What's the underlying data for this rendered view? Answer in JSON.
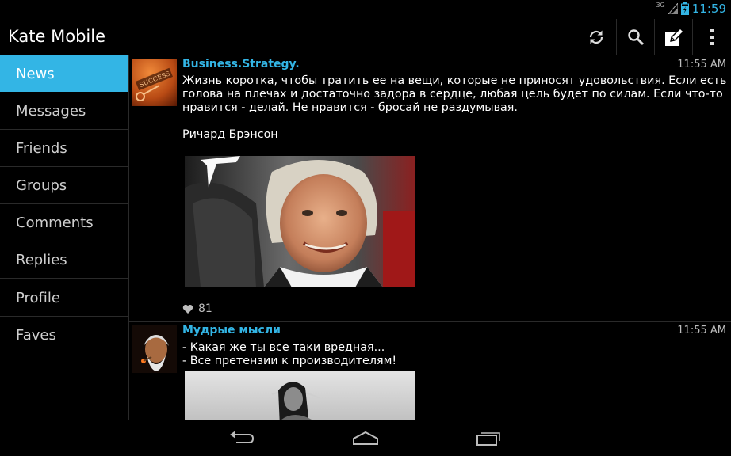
{
  "status": {
    "network": "3G",
    "time": "11:59"
  },
  "app": {
    "title": "Kate Mobile"
  },
  "actions": [
    "refresh-icon",
    "search-icon",
    "compose-icon",
    "overflow-menu-icon"
  ],
  "sidebar": {
    "items": [
      {
        "label": "News",
        "active": true
      },
      {
        "label": "Messages",
        "active": false
      },
      {
        "label": "Friends",
        "active": false
      },
      {
        "label": "Groups",
        "active": false
      },
      {
        "label": "Comments",
        "active": false
      },
      {
        "label": "Replies",
        "active": false
      },
      {
        "label": "Profile",
        "active": false
      },
      {
        "label": "Faves",
        "active": false
      }
    ]
  },
  "posts": [
    {
      "author": "Business.Strategy.",
      "time": "11:55 AM",
      "text_lines": [
        "Жизнь коротка, чтобы тратить ее на вещи, которые не приносят удовольствия. Если есть",
        "голова на плечах и достаточно задора в сердце, любая цель будет по силам. Если что-то",
        "нравится - делай. Не нравится - бросай не раздумывая."
      ],
      "signature": "Ричард Брэнсон",
      "avatar_text": "SUCCESS",
      "likes": "81"
    },
    {
      "author": "Мудрые мысли",
      "time": "11:55 AM",
      "text_lines": [
        "- Какая же ты все таки вредная...",
        "- Все претензии к производителям!"
      ]
    }
  ],
  "colors": {
    "accent": "#33b5e5",
    "background": "#000000"
  },
  "navbar": [
    "back-icon",
    "home-icon",
    "recent-apps-icon"
  ]
}
